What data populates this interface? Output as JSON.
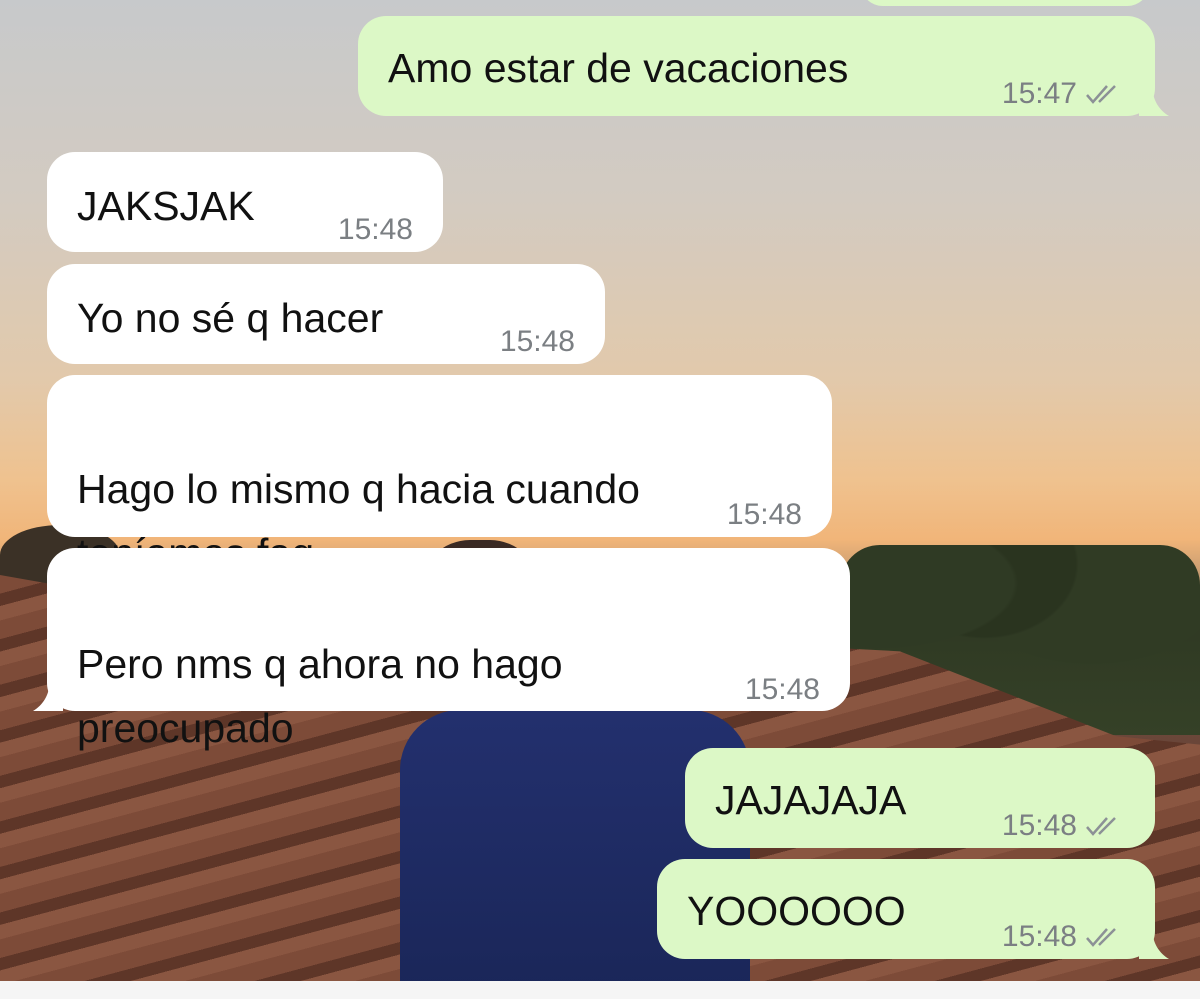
{
  "messages": [
    {
      "dir": "out",
      "text": "Amo estar de vacaciones",
      "time": "15:47",
      "status_icon": "double-check-icon"
    },
    {
      "dir": "in",
      "text": "JAKSJAK",
      "time": "15:48"
    },
    {
      "dir": "in",
      "text": "Yo no sé q hacer",
      "time": "15:48"
    },
    {
      "dir": "in",
      "text": "Hago lo mismo q hacia cuando\nteníamos faq",
      "time": "15:48"
    },
    {
      "dir": "in",
      "text": "Pero nms q ahora no hago\npreocupado",
      "time": "15:48"
    },
    {
      "dir": "out",
      "text": "JAJAJAJA",
      "time": "15:48",
      "status_icon": "double-check-icon"
    },
    {
      "dir": "out",
      "text": "YOOOOOO",
      "time": "15:48",
      "status_icon": "double-check-icon"
    }
  ],
  "colors": {
    "outgoing_bubble": "#dcf8c6",
    "incoming_bubble": "#ffffff",
    "timestamp": "#7b7f83"
  }
}
